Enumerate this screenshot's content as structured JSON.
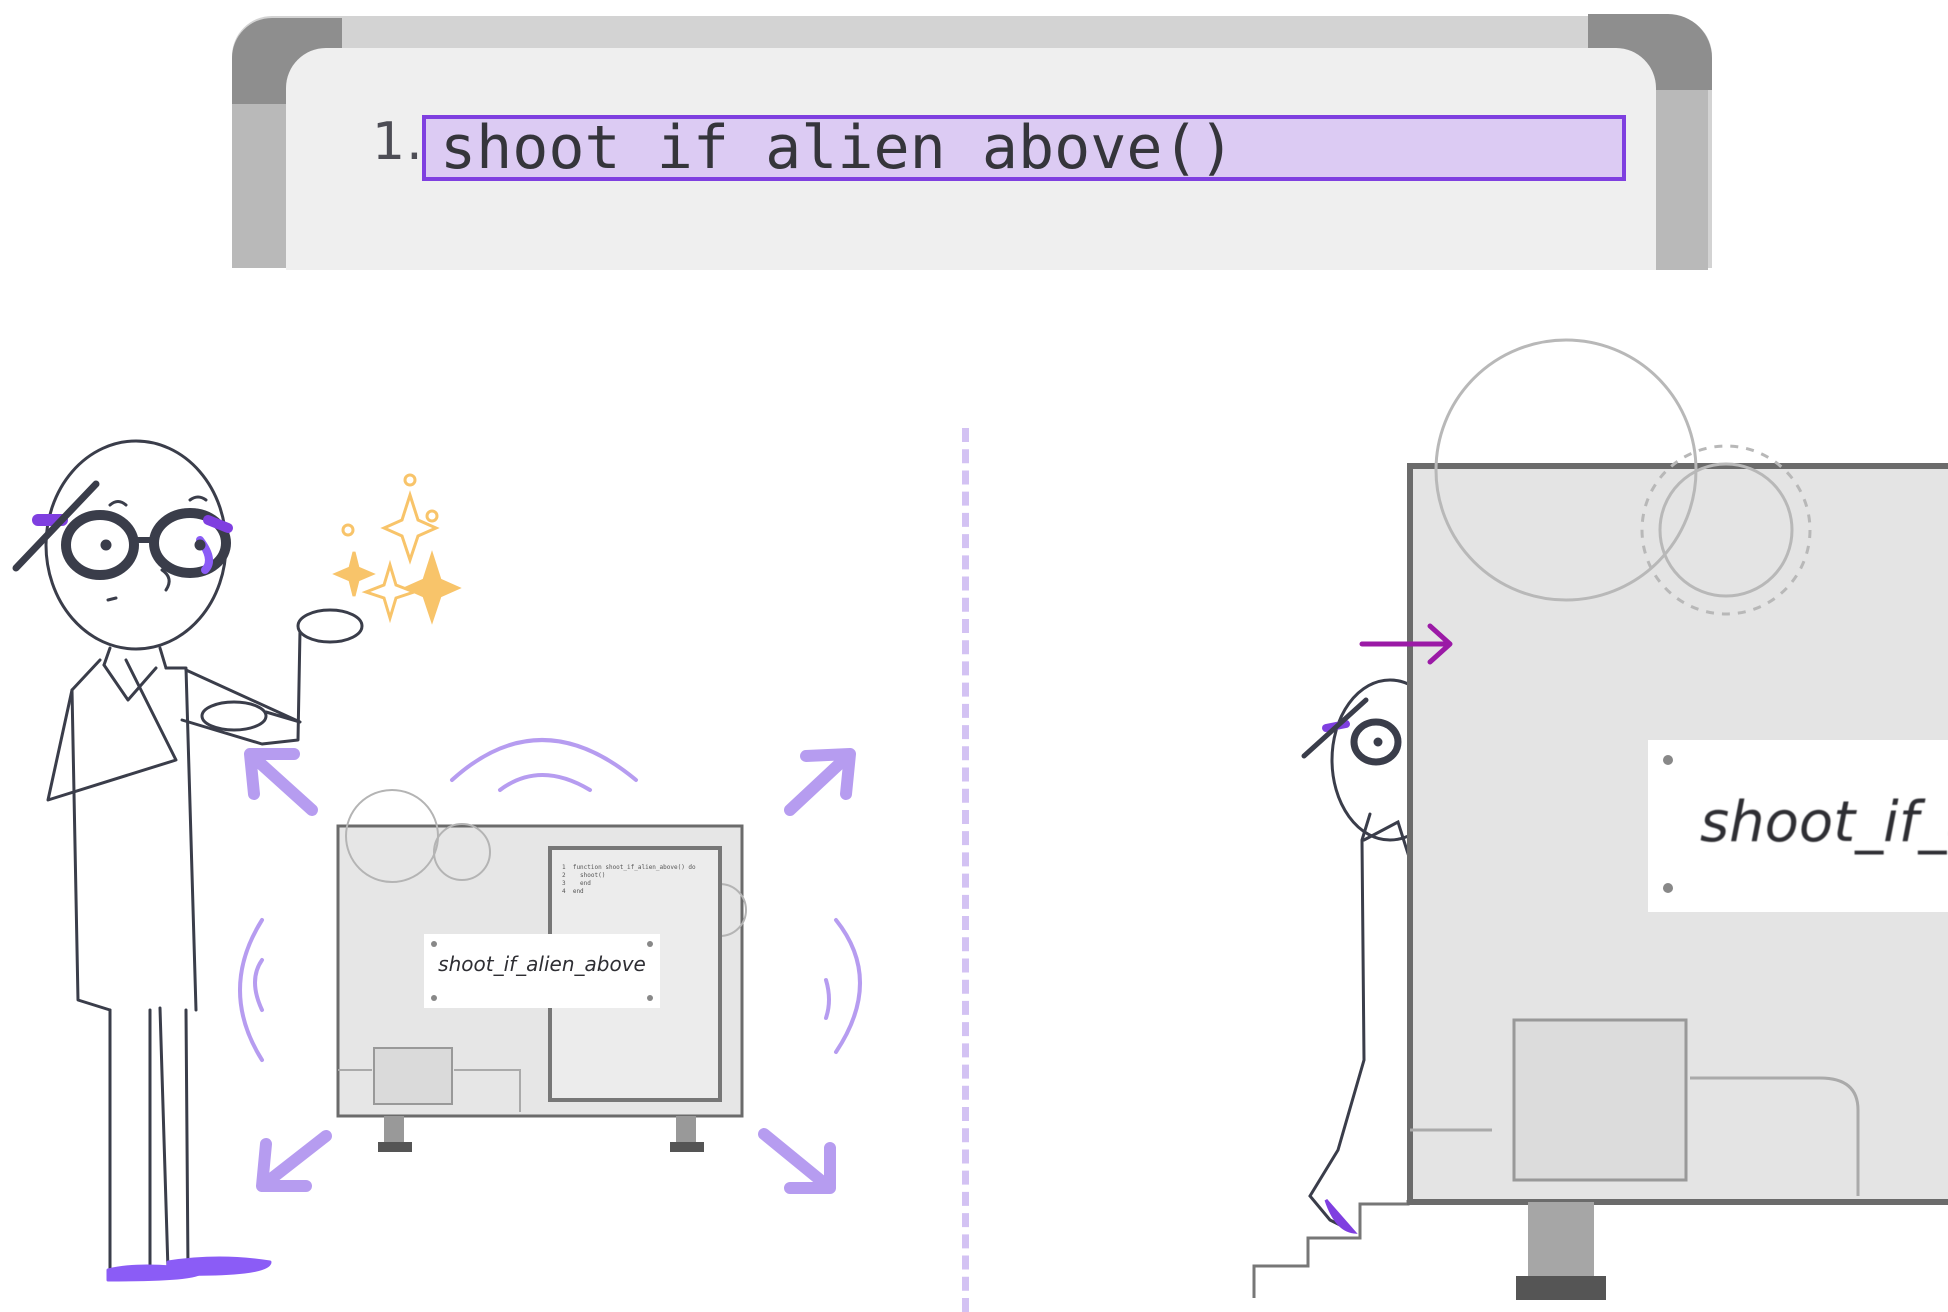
{
  "whiteboard": {
    "line_number": "1.",
    "code_line": "shoot_if_alien_above()"
  },
  "left_panel": {
    "plate_text": "shoot_if_alien_above",
    "code_lines": [
      "1  function shoot_if_alien_above() do",
      "2    shoot()",
      "3    end",
      "4  end"
    ]
  },
  "right_panel": {
    "plate_text": "shoot_if_a"
  },
  "colors": {
    "accent_purple": "#7f3fe0",
    "highlight": "#dccbf3",
    "sparkle": "#f8c46a",
    "arrow_magenta": "#9b1aa6"
  }
}
